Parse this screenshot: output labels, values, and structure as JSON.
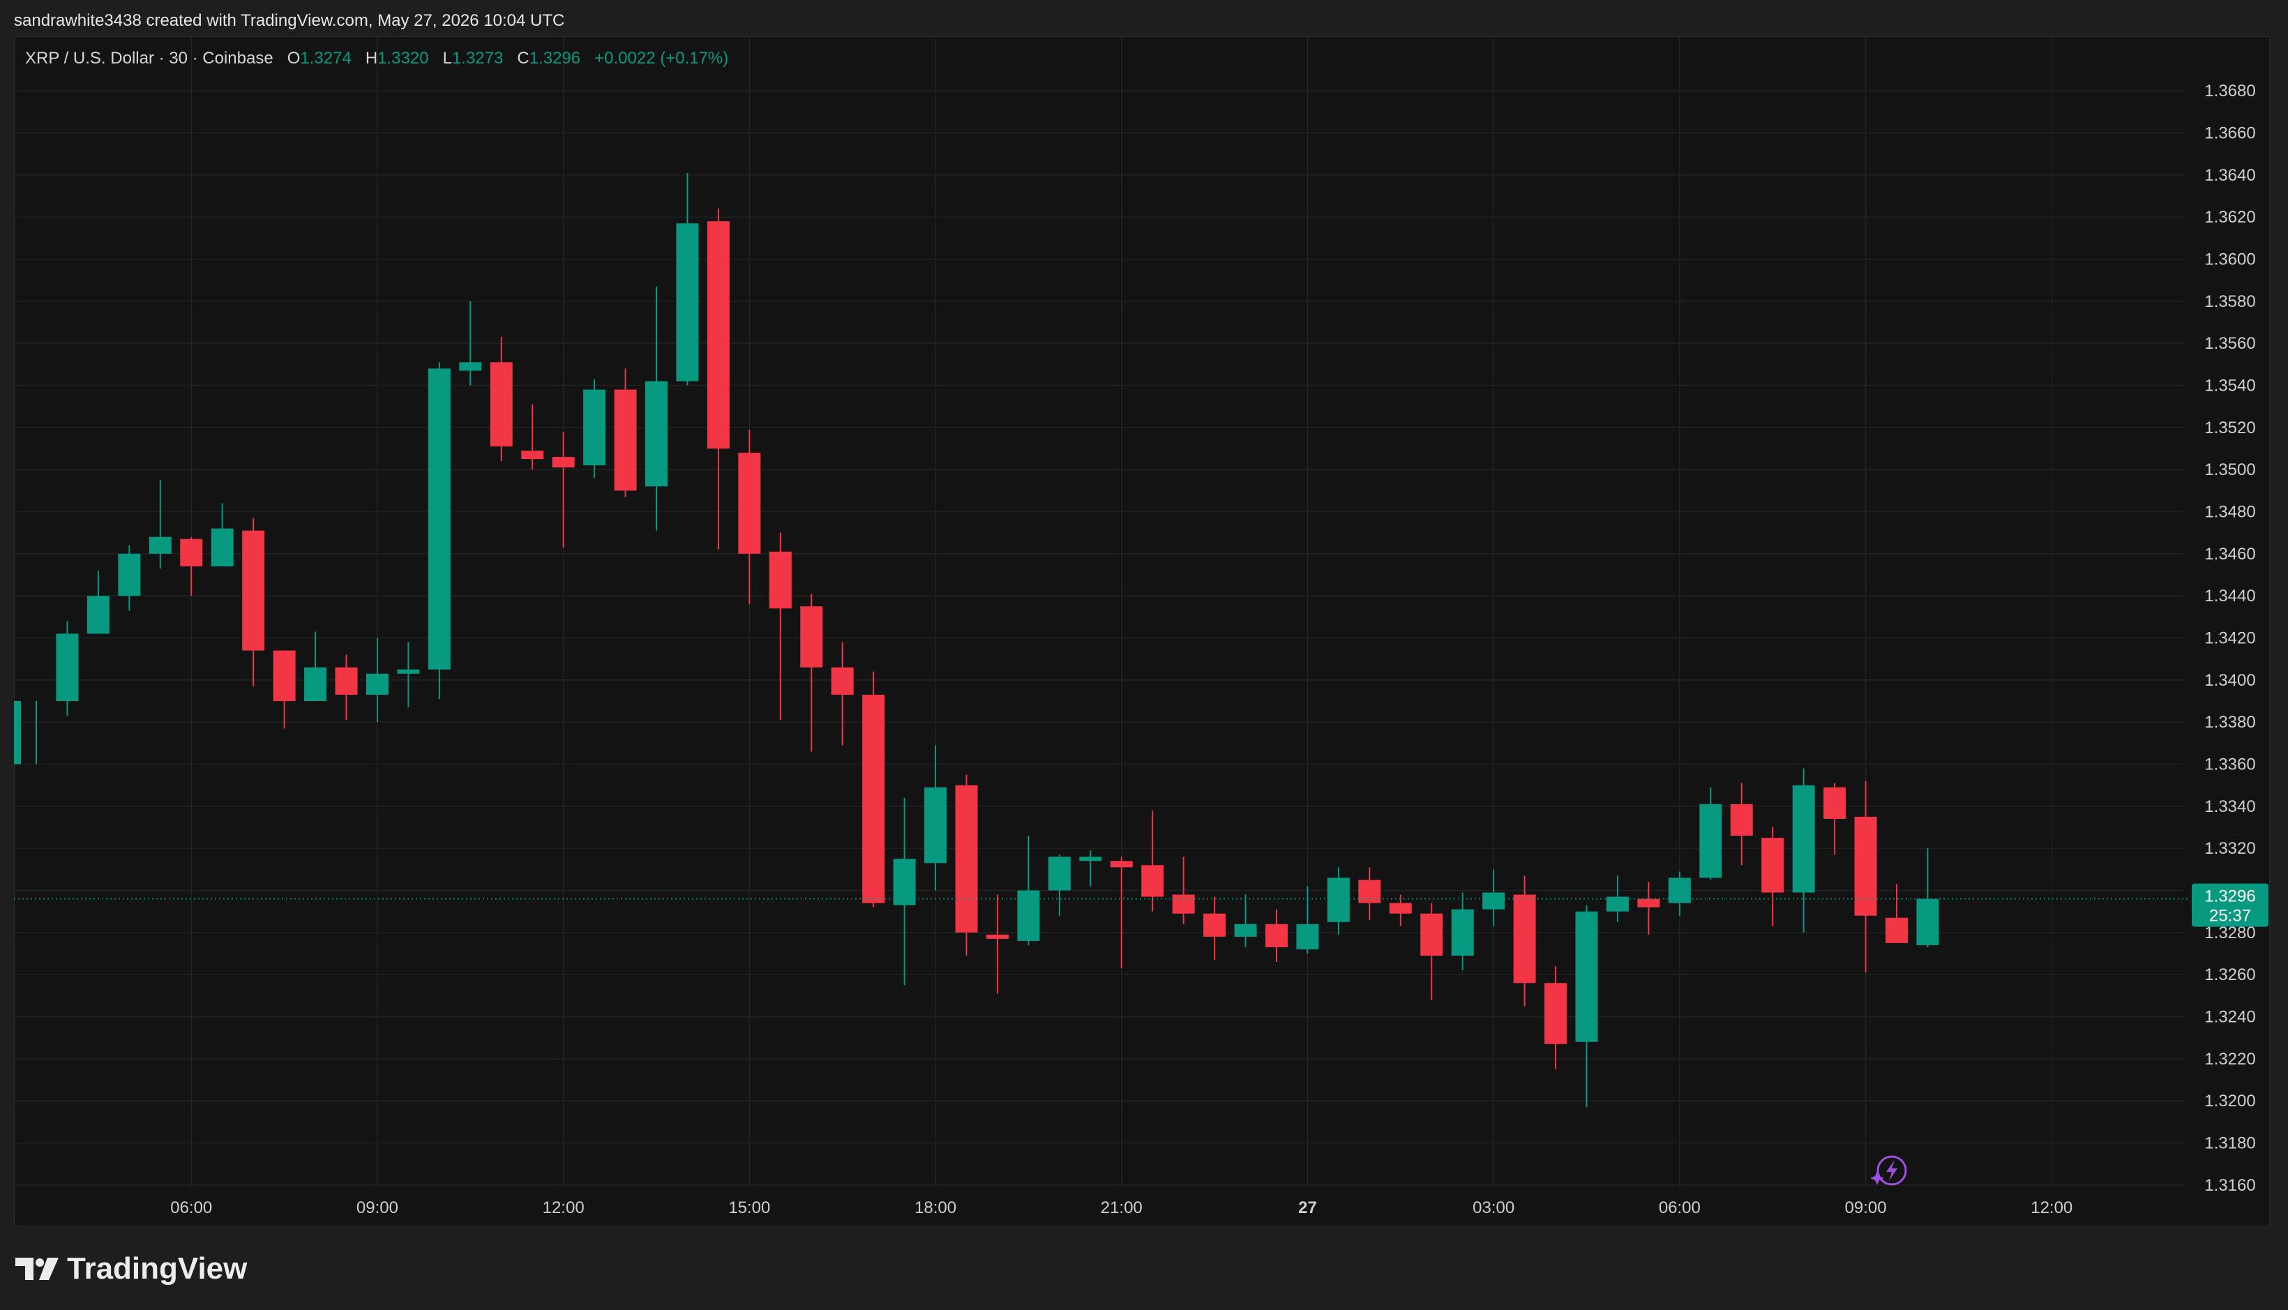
{
  "header": {
    "attribution": "sandrawhite3438 created with TradingView.com, May 27, 2026 10:04 UTC"
  },
  "legend": {
    "symbol": "XRP / U.S. Dollar · 30 · Coinbase",
    "open_label": "O",
    "open": "1.3274",
    "high_label": "H",
    "high": "1.3320",
    "low_label": "L",
    "low": "1.3273",
    "close_label": "C",
    "close": "1.3296",
    "change": "+0.0022 (+0.17%)"
  },
  "price_tag": {
    "price": "1.3296",
    "countdown": "25:37"
  },
  "footer": {
    "logo_text": "TradingView"
  },
  "colors": {
    "up": "#089981",
    "down": "#f23645",
    "background": "#131313",
    "grid": "#222222",
    "axis_text": "#cfcfcf"
  },
  "chart_data": {
    "type": "candlestick",
    "interval": "30",
    "y_ticks": [
      "1.3160",
      "1.3180",
      "1.3200",
      "1.3220",
      "1.3240",
      "1.3260",
      "1.3280",
      "1.3300",
      "1.3320",
      "1.3340",
      "1.3360",
      "1.3380",
      "1.3400",
      "1.3420",
      "1.3440",
      "1.3460",
      "1.3480",
      "1.3500",
      "1.3520",
      "1.3540",
      "1.3560",
      "1.3580",
      "1.3600",
      "1.3620",
      "1.3640",
      "1.3660",
      "1.3680"
    ],
    "ylim": [
      1.315,
      1.369
    ],
    "x_ticks": [
      {
        "label": "06:00",
        "index": 5
      },
      {
        "label": "09:00",
        "index": 11
      },
      {
        "label": "12:00",
        "index": 17
      },
      {
        "label": "15:00",
        "index": 23
      },
      {
        "label": "18:00",
        "index": 29
      },
      {
        "label": "21:00",
        "index": 35
      },
      {
        "label": "27",
        "index": 41
      },
      {
        "label": "03:00",
        "index": 47
      },
      {
        "label": "06:00",
        "index": 53
      },
      {
        "label": "09:00",
        "index": 59
      },
      {
        "label": "12:00",
        "index": 65
      }
    ],
    "grid": true,
    "current_price": 1.3296,
    "candles": [
      {
        "o": 1.336,
        "h": 1.339,
        "l": 1.336,
        "c": 1.339
      },
      {
        "o": 1.339,
        "h": 1.3428,
        "l": 1.3383,
        "c": 1.3422
      },
      {
        "o": 1.3422,
        "h": 1.3452,
        "l": 1.3422,
        "c": 1.344
      },
      {
        "o": 1.344,
        "h": 1.3464,
        "l": 1.3433,
        "c": 1.346
      },
      {
        "o": 1.346,
        "h": 1.3495,
        "l": 1.3453,
        "c": 1.3468
      },
      {
        "o": 1.3467,
        "h": 1.3468,
        "l": 1.344,
        "c": 1.3454
      },
      {
        "o": 1.3454,
        "h": 1.3484,
        "l": 1.3454,
        "c": 1.3472
      },
      {
        "o": 1.3471,
        "h": 1.3477,
        "l": 1.3397,
        "c": 1.3414
      },
      {
        "o": 1.3414,
        "h": 1.3414,
        "l": 1.3377,
        "c": 1.339
      },
      {
        "o": 1.339,
        "h": 1.3423,
        "l": 1.339,
        "c": 1.3406
      },
      {
        "o": 1.3406,
        "h": 1.3412,
        "l": 1.3381,
        "c": 1.3393
      },
      {
        "o": 1.3393,
        "h": 1.342,
        "l": 1.338,
        "c": 1.3403
      },
      {
        "o": 1.3403,
        "h": 1.3418,
        "l": 1.3387,
        "c": 1.3405
      },
      {
        "o": 1.3405,
        "h": 1.3551,
        "l": 1.3391,
        "c": 1.3548
      },
      {
        "o": 1.3547,
        "h": 1.358,
        "l": 1.354,
        "c": 1.3551
      },
      {
        "o": 1.3551,
        "h": 1.3563,
        "l": 1.3504,
        "c": 1.3511
      },
      {
        "o": 1.3509,
        "h": 1.3531,
        "l": 1.35,
        "c": 1.3505
      },
      {
        "o": 1.3506,
        "h": 1.3518,
        "l": 1.3463,
        "c": 1.3501
      },
      {
        "o": 1.3502,
        "h": 1.3543,
        "l": 1.3496,
        "c": 1.3538
      },
      {
        "o": 1.3538,
        "h": 1.3548,
        "l": 1.3487,
        "c": 1.349
      },
      {
        "o": 1.3492,
        "h": 1.3587,
        "l": 1.3471,
        "c": 1.3542
      },
      {
        "o": 1.3542,
        "h": 1.3641,
        "l": 1.354,
        "c": 1.3617
      },
      {
        "o": 1.3618,
        "h": 1.3624,
        "l": 1.3462,
        "c": 1.351
      },
      {
        "o": 1.3508,
        "h": 1.3519,
        "l": 1.3436,
        "c": 1.346
      },
      {
        "o": 1.3461,
        "h": 1.347,
        "l": 1.3381,
        "c": 1.3434
      },
      {
        "o": 1.3435,
        "h": 1.3441,
        "l": 1.3366,
        "c": 1.3406
      },
      {
        "o": 1.3406,
        "h": 1.3418,
        "l": 1.3369,
        "c": 1.3393
      },
      {
        "o": 1.3393,
        "h": 1.3404,
        "l": 1.3292,
        "c": 1.3294
      },
      {
        "o": 1.3293,
        "h": 1.3344,
        "l": 1.3255,
        "c": 1.3315
      },
      {
        "o": 1.3313,
        "h": 1.3369,
        "l": 1.33,
        "c": 1.3349
      },
      {
        "o": 1.335,
        "h": 1.3355,
        "l": 1.3269,
        "c": 1.328
      },
      {
        "o": 1.3279,
        "h": 1.3298,
        "l": 1.3251,
        "c": 1.3277
      },
      {
        "o": 1.3276,
        "h": 1.3326,
        "l": 1.3274,
        "c": 1.33
      },
      {
        "o": 1.33,
        "h": 1.3317,
        "l": 1.3288,
        "c": 1.3316
      },
      {
        "o": 1.3314,
        "h": 1.3319,
        "l": 1.3302,
        "c": 1.3316
      },
      {
        "o": 1.3314,
        "h": 1.3316,
        "l": 1.3263,
        "c": 1.3311
      },
      {
        "o": 1.3312,
        "h": 1.3338,
        "l": 1.329,
        "c": 1.3297
      },
      {
        "o": 1.3298,
        "h": 1.3316,
        "l": 1.3284,
        "c": 1.3289
      },
      {
        "o": 1.3289,
        "h": 1.3297,
        "l": 1.3267,
        "c": 1.3278
      },
      {
        "o": 1.3278,
        "h": 1.3298,
        "l": 1.3273,
        "c": 1.3284
      },
      {
        "o": 1.3284,
        "h": 1.3291,
        "l": 1.3266,
        "c": 1.3273
      },
      {
        "o": 1.3272,
        "h": 1.3302,
        "l": 1.327,
        "c": 1.3284
      },
      {
        "o": 1.3285,
        "h": 1.3311,
        "l": 1.3279,
        "c": 1.3306
      },
      {
        "o": 1.3305,
        "h": 1.3311,
        "l": 1.3286,
        "c": 1.3294
      },
      {
        "o": 1.3294,
        "h": 1.3298,
        "l": 1.3283,
        "c": 1.3289
      },
      {
        "o": 1.3289,
        "h": 1.3294,
        "l": 1.3248,
        "c": 1.3269
      },
      {
        "o": 1.3269,
        "h": 1.3299,
        "l": 1.3262,
        "c": 1.3291
      },
      {
        "o": 1.3291,
        "h": 1.331,
        "l": 1.3283,
        "c": 1.3299
      },
      {
        "o": 1.3298,
        "h": 1.3307,
        "l": 1.3245,
        "c": 1.3256
      },
      {
        "o": 1.3256,
        "h": 1.3264,
        "l": 1.3215,
        "c": 1.3227
      },
      {
        "o": 1.3228,
        "h": 1.3293,
        "l": 1.3197,
        "c": 1.329
      },
      {
        "o": 1.329,
        "h": 1.3307,
        "l": 1.3285,
        "c": 1.3297
      },
      {
        "o": 1.3296,
        "h": 1.3304,
        "l": 1.3279,
        "c": 1.3292
      },
      {
        "o": 1.3294,
        "h": 1.3309,
        "l": 1.3288,
        "c": 1.3306
      },
      {
        "o": 1.3306,
        "h": 1.3349,
        "l": 1.3305,
        "c": 1.3341
      },
      {
        "o": 1.3341,
        "h": 1.3351,
        "l": 1.3312,
        "c": 1.3326
      },
      {
        "o": 1.3325,
        "h": 1.333,
        "l": 1.3283,
        "c": 1.3299
      },
      {
        "o": 1.3299,
        "h": 1.3358,
        "l": 1.328,
        "c": 1.335
      },
      {
        "o": 1.3349,
        "h": 1.3351,
        "l": 1.3317,
        "c": 1.3334
      },
      {
        "o": 1.3335,
        "h": 1.3352,
        "l": 1.3261,
        "c": 1.3288
      },
      {
        "o": 1.3287,
        "h": 1.3303,
        "l": 1.3275,
        "c": 1.3275
      },
      {
        "o": 1.3274,
        "h": 1.332,
        "l": 1.3273,
        "c": 1.3296
      }
    ]
  }
}
